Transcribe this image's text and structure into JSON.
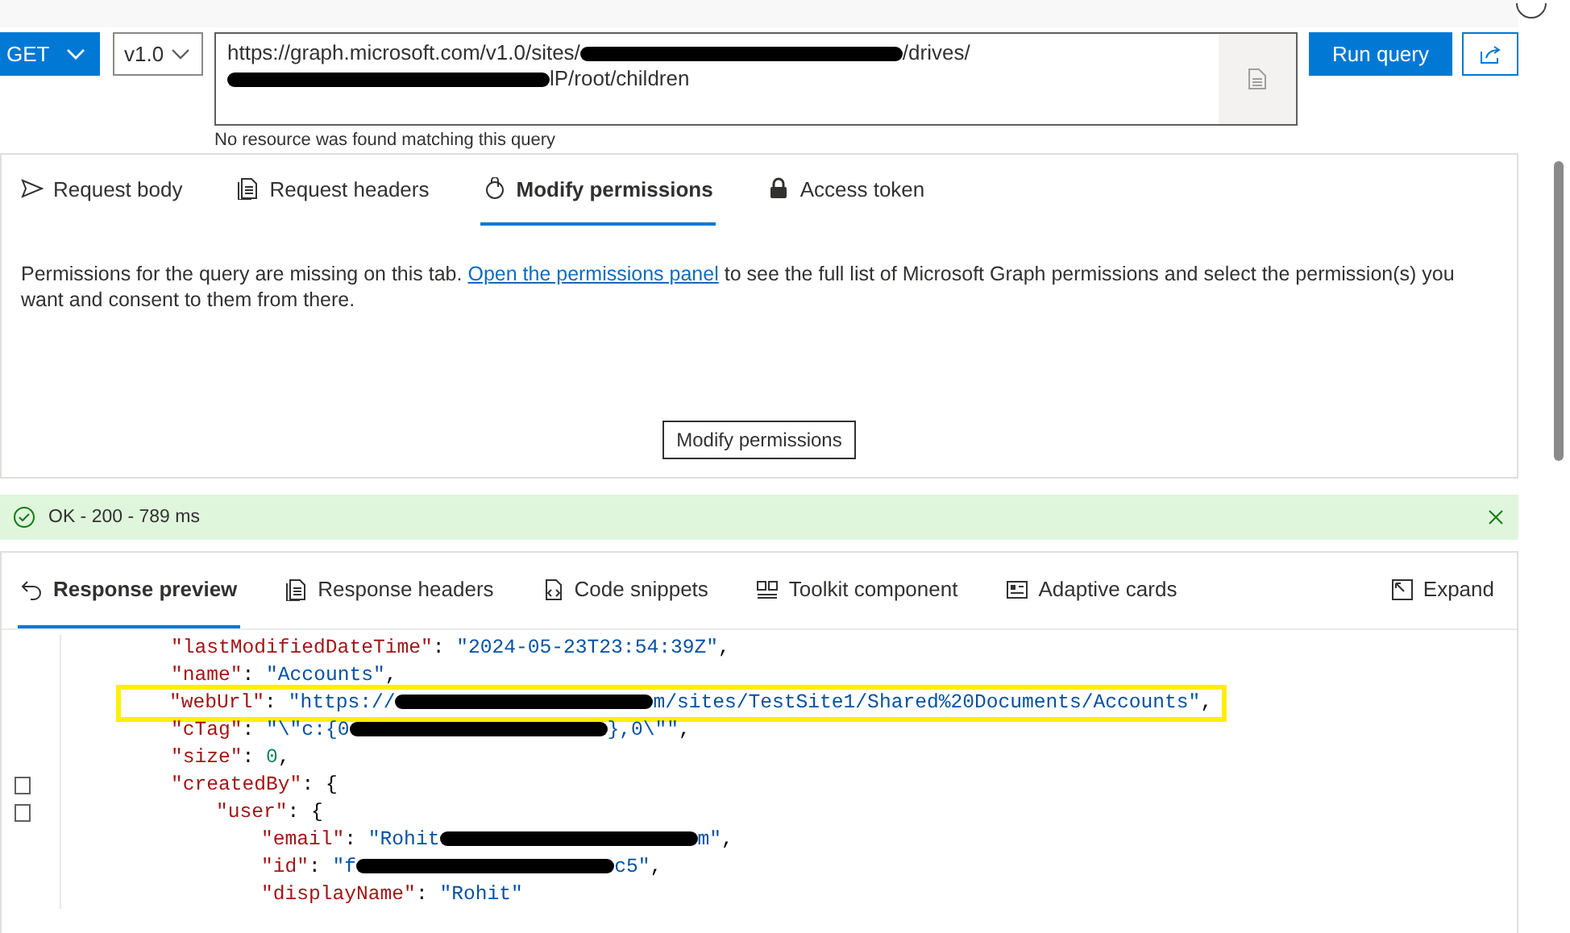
{
  "query": {
    "method": "GET",
    "version": "v1.0",
    "url_parts": [
      {
        "kind": "text",
        "text": "https://graph.microsoft.com/v1.0/sites/"
      },
      {
        "kind": "redaction"
      },
      {
        "kind": "text",
        "text": "/drives/"
      },
      {
        "kind": "redaction"
      },
      {
        "kind": "text",
        "text": "lP/root/children"
      }
    ],
    "run_button": "Run query",
    "message": "No resource was found matching this query"
  },
  "request_tabs": [
    {
      "label": "Request body",
      "selected": false
    },
    {
      "label": "Request headers",
      "selected": false
    },
    {
      "label": "Modify permissions",
      "selected": true
    },
    {
      "label": "Access token",
      "selected": false
    }
  ],
  "permissions": {
    "text_before": "Permissions for the query are missing on this tab. ",
    "link": "Open the permissions panel",
    "text_after": " to see the full list of Microsoft Graph permissions and select the permission(s) you want and consent to them from there.",
    "button": "Modify permissions"
  },
  "status": {
    "kind": "success",
    "text": "OK - 200 - 789 ms"
  },
  "response_tabs": [
    {
      "label": "Response preview",
      "selected": true
    },
    {
      "label": "Response headers",
      "selected": false
    },
    {
      "label": "Code snippets",
      "selected": false
    },
    {
      "label": "Toolkit component",
      "selected": false
    },
    {
      "label": "Adaptive cards",
      "selected": false
    }
  ],
  "expand_button": "Expand",
  "code_lines": [
    {
      "highlighted": false,
      "foldable": false,
      "parts": [
        {
          "kind": "key",
          "text": "\"lastModifiedDateTime\""
        },
        {
          "kind": "punct",
          "text": ": "
        },
        {
          "kind": "string",
          "text": "\"2024-05-23T23:54:39Z\""
        },
        {
          "kind": "punct",
          "text": ","
        }
      ]
    },
    {
      "highlighted": false,
      "foldable": false,
      "parts": [
        {
          "kind": "key",
          "text": "\"name\""
        },
        {
          "kind": "punct",
          "text": ": "
        },
        {
          "kind": "string",
          "text": "\"Accounts\""
        },
        {
          "kind": "punct",
          "text": ","
        }
      ]
    },
    {
      "highlighted": true,
      "foldable": false,
      "parts": [
        {
          "kind": "key",
          "text": "\"webUrl\""
        },
        {
          "kind": "punct",
          "text": ": "
        },
        {
          "kind": "string",
          "text": "\"https://"
        },
        {
          "kind": "redaction"
        },
        {
          "kind": "string",
          "text": "m/sites/TestSite1/Shared%20Documents/Accounts\""
        },
        {
          "kind": "punct",
          "text": ","
        }
      ]
    },
    {
      "highlighted": false,
      "foldable": false,
      "parts": [
        {
          "kind": "key",
          "text": "\"cTag\""
        },
        {
          "kind": "punct",
          "text": ": "
        },
        {
          "kind": "string",
          "text": "\"\\\"c:{0"
        },
        {
          "kind": "redaction"
        },
        {
          "kind": "string",
          "text": "},0\\\"\""
        },
        {
          "kind": "punct",
          "text": ","
        }
      ]
    },
    {
      "highlighted": false,
      "foldable": false,
      "parts": [
        {
          "kind": "key",
          "text": "\"size\""
        },
        {
          "kind": "punct",
          "text": ": "
        },
        {
          "kind": "number",
          "text": "0"
        },
        {
          "kind": "punct",
          "text": ","
        }
      ]
    },
    {
      "highlighted": false,
      "foldable": true,
      "parts": [
        {
          "kind": "key",
          "text": "\"createdBy\""
        },
        {
          "kind": "punct",
          "text": ": {"
        }
      ],
      "children": [
        {
          "highlighted": false,
          "foldable": true,
          "parts": [
            {
              "kind": "key",
              "text": "\"user\""
            },
            {
              "kind": "punct",
              "text": ": {"
            }
          ],
          "children": [
            {
              "highlighted": false,
              "foldable": false,
              "parts": [
                {
                  "kind": "key",
                  "text": "\"email\""
                },
                {
                  "kind": "punct",
                  "text": ": "
                },
                {
                  "kind": "string",
                  "text": "\"Rohit"
                },
                {
                  "kind": "redaction"
                },
                {
                  "kind": "string",
                  "text": "m\""
                },
                {
                  "kind": "punct",
                  "text": ","
                }
              ]
            },
            {
              "highlighted": false,
              "foldable": false,
              "parts": [
                {
                  "kind": "key",
                  "text": "\"id\""
                },
                {
                  "kind": "punct",
                  "text": ": "
                },
                {
                  "kind": "string",
                  "text": "\"f"
                },
                {
                  "kind": "redaction"
                },
                {
                  "kind": "string",
                  "text": "c5\""
                },
                {
                  "kind": "punct",
                  "text": ","
                }
              ]
            },
            {
              "highlighted": false,
              "foldable": false,
              "parts": [
                {
                  "kind": "key",
                  "text": "\"displayName\""
                },
                {
                  "kind": "punct",
                  "text": ": "
                },
                {
                  "kind": "string",
                  "text": "\"Rohit\""
                }
              ]
            }
          ]
        }
      ]
    }
  ]
}
